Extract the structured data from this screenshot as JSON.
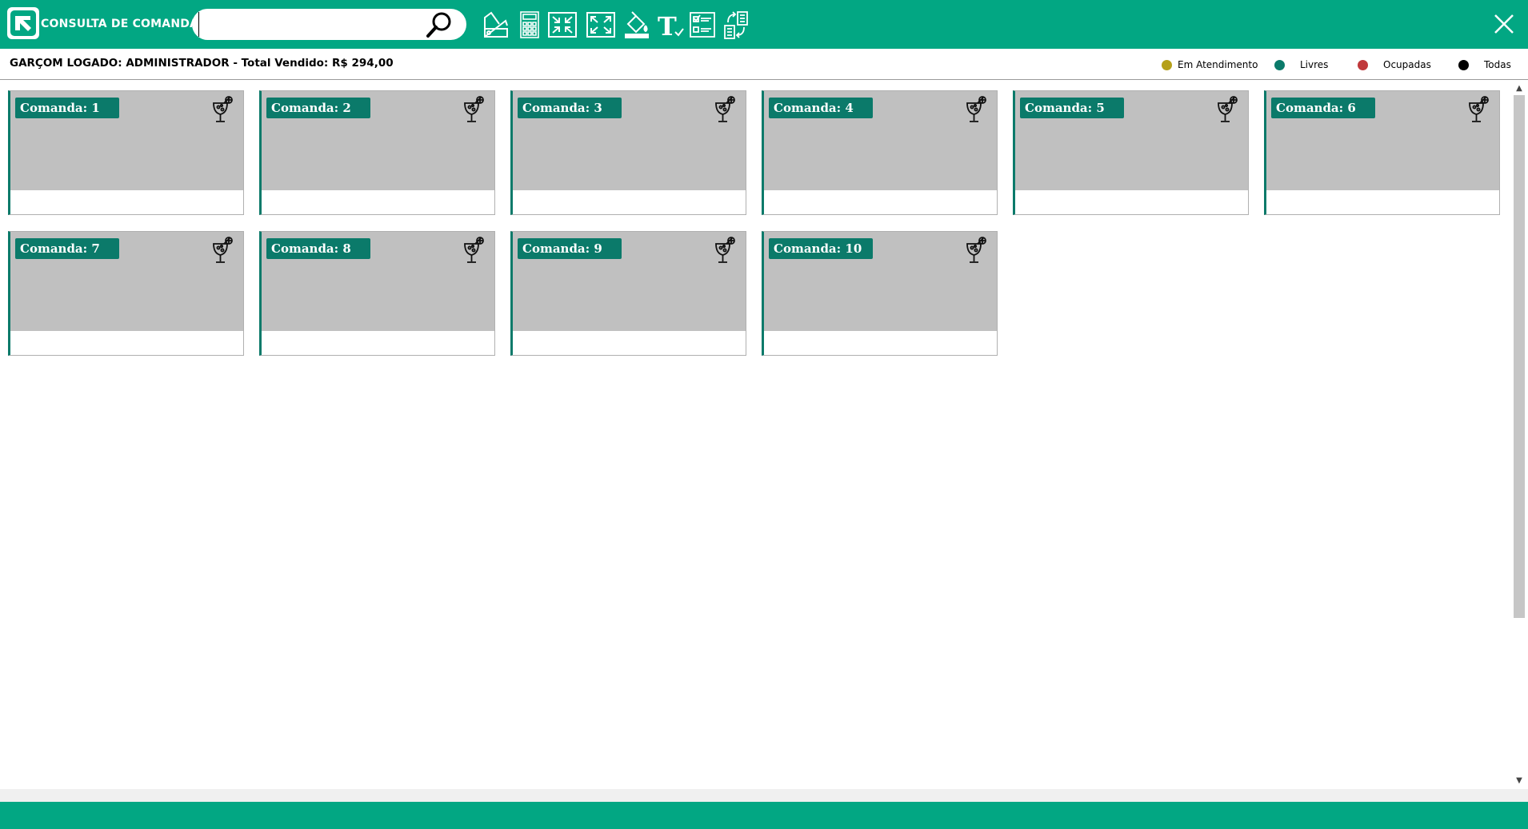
{
  "header": {
    "search_label": "CONSULTA DE COMANDAS:",
    "search_value": "",
    "search_placeholder": "",
    "logo_icon": "app-logo-arrow-icon",
    "tools": [
      {
        "name": "palette-icon"
      },
      {
        "name": "calculator-icon"
      },
      {
        "name": "collapse-icon"
      },
      {
        "name": "expand-icon"
      },
      {
        "name": "fill-color-icon"
      },
      {
        "name": "text-size-icon"
      },
      {
        "name": "checklist-icon"
      },
      {
        "name": "transfer-icon"
      }
    ],
    "close_icon": "close-icon",
    "accent_color": "#02a783"
  },
  "info": {
    "text": "GARÇOM LOGADO: ADMINISTRADOR - Total Vendido: R$ 294,00"
  },
  "legend": [
    {
      "label": "Em Atendimento",
      "color": "#b5a019"
    },
    {
      "label": "Livres",
      "color": "#0b7a6a"
    },
    {
      "label": "Ocupadas",
      "color": "#c0393b"
    },
    {
      "label": "Todas",
      "color": "#000000"
    }
  ],
  "cards": [
    {
      "label": "Comanda: 1"
    },
    {
      "label": "Comanda: 2"
    },
    {
      "label": "Comanda: 3"
    },
    {
      "label": "Comanda: 4"
    },
    {
      "label": "Comanda: 5"
    },
    {
      "label": "Comanda: 6"
    },
    {
      "label": "Comanda: 7"
    },
    {
      "label": "Comanda: 8"
    },
    {
      "label": "Comanda: 9"
    },
    {
      "label": "Comanda: 10"
    }
  ],
  "card_colors": {
    "badge": "#0b7a6a",
    "body": "#c0c0c0"
  }
}
